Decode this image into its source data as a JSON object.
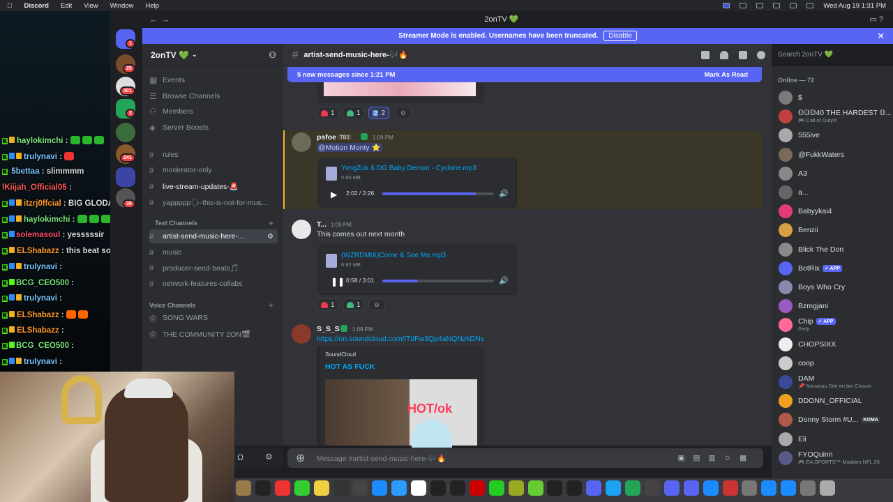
{
  "menubar": {
    "apple": "",
    "items": [
      "Discord",
      "Edit",
      "View",
      "Window",
      "Help"
    ],
    "clock": "Wed Aug 19  1:31 PM"
  },
  "window": {
    "title": "2onTV 💚"
  },
  "streamer_banner": {
    "text": "Streamer Mode is enabled. Usernames have been truncated.",
    "disable": "Disable"
  },
  "stream_chat": [
    {
      "user": "haylokimchi",
      "msg": ":",
      "color": "#7ee87e"
    },
    {
      "user": "trulynavi",
      "msg": ":",
      "color": "#7ac7ff"
    },
    {
      "user": "5bettaa",
      "msg": ": slimmmm",
      "color": "#7ac7ff"
    },
    {
      "user": "lKiijah_Official05",
      "msg": ":",
      "color": "#ff5a5a"
    },
    {
      "user": "itzrj0ffcial",
      "msg": ": BIG GLODAY!!",
      "color": "#ff9a2e"
    },
    {
      "user": "haylokimchi",
      "msg": ":",
      "color": "#7ee87e"
    },
    {
      "user": "solemasoul",
      "msg": ": yesssssir",
      "color": "#ff4d6d"
    },
    {
      "user": "ELShabazz",
      "msg": ": this beat sounds smooth",
      "color": "#ff9a2e"
    },
    {
      "user": "trulynavi",
      "msg": ":",
      "color": "#7ac7ff"
    },
    {
      "user": "BCG_CEO500",
      "msg": ":",
      "color": "#7ee87e"
    },
    {
      "user": "trulynavi",
      "msg": ":",
      "color": "#7ac7ff"
    },
    {
      "user": "ELShabazz",
      "msg": ":",
      "color": "#ff9a2e"
    },
    {
      "user": "ELShabazz",
      "msg": ":",
      "color": "#ff9a2e"
    },
    {
      "user": "BCG_CEO500",
      "msg": ":",
      "color": "#7ee87e"
    },
    {
      "user": "trulynavi",
      "msg": ":",
      "color": "#7ac7ff"
    }
  ],
  "guild_badges": [
    "1",
    "25",
    "301",
    "2",
    "241",
    "39"
  ],
  "server": {
    "name": "2onTV 💚"
  },
  "channels": {
    "top": [
      {
        "icon": "📅",
        "label": "Events"
      },
      {
        "icon": "☰",
        "label": "Browse Channels"
      },
      {
        "icon": "👥",
        "label": "Members"
      },
      {
        "icon": "◈",
        "label": "Server Boosts"
      }
    ],
    "text": [
      {
        "label": "rules"
      },
      {
        "label": "moderator-only"
      },
      {
        "label": "live-stream-updates-🚨"
      },
      {
        "label": "yappppp🗣-this-is-not-for-mus..."
      }
    ],
    "cat_text": "Text Channels",
    "music": [
      {
        "label": "artist-send-music-here-..."
      },
      {
        "label": "music"
      },
      {
        "label": "producer-send-beats🎵"
      },
      {
        "label": "network-features-collabs"
      }
    ],
    "cat_voice": "Voice Channels",
    "voice": [
      {
        "label": "SONG WARS"
      },
      {
        "label": "THE COMMUNITY 2ON🎬"
      }
    ]
  },
  "header": {
    "channel": "artist-send-music-here-🎶🔥",
    "search_placeholder": "Search 2onTV 💚"
  },
  "new_messages": {
    "text": "5 new messages since 1:21 PM",
    "action": "Mark As Read"
  },
  "reactions_top": [
    {
      "emoji": "heart",
      "count": "1"
    },
    {
      "emoji": "green-heart",
      "count": "1"
    },
    {
      "emoji": "two",
      "count": "2"
    }
  ],
  "messages": [
    {
      "user": "psfoe",
      "tag": "TB3",
      "time": "1:09 PM",
      "mention": "@Motion Monty ⭐",
      "file": "YvngZuk & DG Baby Demon - Cyclone.mp3",
      "size": "5.60 MB",
      "position": "2:02 / 2:26",
      "progress": 0.84
    },
    {
      "user": "T...",
      "time": "1:09 PM",
      "text": "This comes out next month",
      "file": "(WZRDMIX)Come & See Me.mp3",
      "size": "6.92 MB",
      "position": "0:58 / 3:01",
      "progress": 0.32,
      "reactions": [
        "1",
        "1"
      ]
    },
    {
      "user": "S_S_S",
      "time": "1:09 PM",
      "link": "https://on.soundcloud.com/lTdFw3Qp4aNQNzkDNs",
      "embed_provider": "SoundCloud",
      "embed_title": "HOT AS FUCK",
      "embed_image_text": "HOT/ok"
    }
  ],
  "composer": {
    "placeholder": "Message #artist-send-music-here-🎶🔥"
  },
  "members": {
    "heading": "Online — 72",
    "list": [
      {
        "name": "$",
        "sub": ""
      },
      {
        "name": "𝕆𝔻𝔻40 THE HARDEST 𝕆...",
        "sub": "🎮 Call of Duty®"
      },
      {
        "name": "555ive",
        "sub": ""
      },
      {
        "name": "@FukkWaters",
        "sub": ""
      },
      {
        "name": "A3",
        "sub": ""
      },
      {
        "name": "a...",
        "sub": ""
      },
      {
        "name": "Babyykai4",
        "sub": ""
      },
      {
        "name": "Benzii",
        "sub": ""
      },
      {
        "name": "Blick The Don",
        "sub": ""
      },
      {
        "name": "BotRix",
        "sub": "",
        "app": "✓ APP"
      },
      {
        "name": "Boys Who Cry",
        "sub": ""
      },
      {
        "name": "Bzmgjani",
        "sub": ""
      },
      {
        "name": "Chip",
        "sub": "/help",
        "app": "✓ APP"
      },
      {
        "name": "CHOPSIXX",
        "sub": ""
      },
      {
        "name": "coop",
        "sub": ""
      },
      {
        "name": "DAM",
        "sub": "📌 Nouveau Site en bio Choum"
      },
      {
        "name": "DDONN_OFFICIAL",
        "sub": ""
      },
      {
        "name": "Donny Storm #U...",
        "sub": "",
        "tag": "KOMA"
      },
      {
        "name": "Eli",
        "sub": ""
      },
      {
        "name": "FYOQuinn",
        "sub": "🎮 EA SPORTS™ Madden NFL 26"
      }
    ]
  },
  "colors": {
    "blurple": "#5865f2",
    "green": "#23a559",
    "highlight": "#f0b232"
  }
}
